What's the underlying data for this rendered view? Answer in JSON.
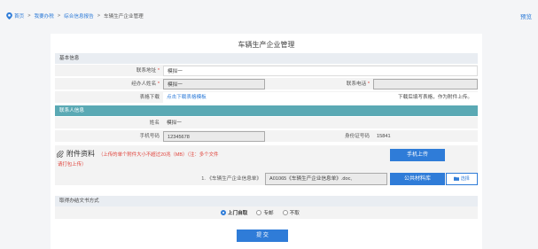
{
  "breadcrumb": {
    "items": [
      "首页",
      "我要办税",
      "综合信息报告"
    ],
    "current": "车辆生产企业管理",
    "separator": ">"
  },
  "preview_label": "预览",
  "form": {
    "title": "车辆生产企业管理",
    "basic_section": "基本信息",
    "contact_address_label": "联系地址",
    "contact_address_value": "模拟一",
    "handler_name_label": "经办人姓名",
    "handler_name_value": "模拟一",
    "phone_label": "联系电话",
    "phone_value": "",
    "form_download_label": "表格下载",
    "form_download_link": "点击下载表格模板",
    "form_download_hint": "下载后填写表格，作为附件上传。",
    "contact_section": "联系人信息",
    "name_label": "姓名",
    "name_value": "模拟一",
    "mobile_label": "手机号码",
    "mobile_value": "12345678",
    "id_label": "身份证号码",
    "id_value": "15841",
    "required_mark": "*"
  },
  "attachments": {
    "title": "附件资料",
    "note": "（上传的单个附件大小不超过20兆（MB）（注：多个文件",
    "note2": "请打包上传）",
    "mobile_upload": "手机上传",
    "item_label": "1. 《车辆生产企业信息单》",
    "item_value": "A01065《车辆生产企业信息单》.doc,",
    "public_library": "公共材料库",
    "choose_file": "选择"
  },
  "delivery": {
    "section": "取得办结文书方式",
    "options": [
      "上门自取",
      "专邮",
      "不取"
    ],
    "selected": "上门自取"
  },
  "submit_label": "提 交",
  "colors": {
    "accent": "#2f7cd8",
    "teal_header": "#5aa9b4",
    "required": "#e0433b"
  },
  "icons": {
    "location": "location-pin-icon",
    "paperclip": "paperclip-icon",
    "folder": "folder-icon"
  }
}
